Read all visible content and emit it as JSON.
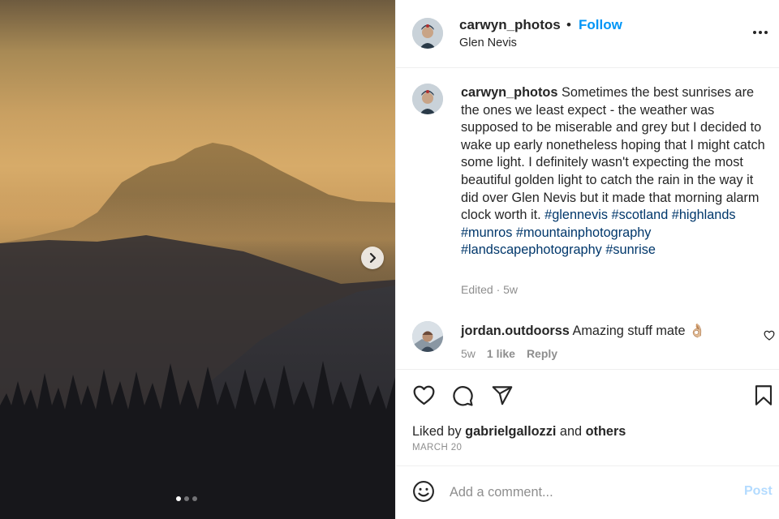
{
  "post": {
    "username": "carwyn_photos",
    "separator": "•",
    "follow_label": "Follow",
    "location": "Glen Nevis",
    "more_icon": "more-horizontal-icon"
  },
  "caption": {
    "username": "carwyn_photos",
    "text": " Sometimes the best sunrises are the ones we least expect - the weather was supposed to be miserable and grey but I decided to wake up early nonetheless hoping that I might catch some light. I definitely wasn't expecting the most beautiful golden light to catch the rain in the way it did over Glen Nevis but it made that morning alarm clock worth it. ",
    "hashtags": [
      "#glennevis",
      "#scotland",
      "#highlands",
      "#munros",
      "#mountainphotography",
      "#landscapephotography",
      "#sunrise"
    ],
    "edited": "Edited · 5w"
  },
  "comment": {
    "username": "jordan.outdoorss",
    "text": " Amazing stuff mate 👌🏼",
    "age": "5w",
    "likes": "1 like",
    "reply_label": "Reply"
  },
  "actions": {
    "liked_prefix": "Liked by ",
    "liked_user": "gabrielgallozzi",
    "liked_and": " and ",
    "liked_others": "others",
    "date": "MARCH 20"
  },
  "composer": {
    "placeholder": "Add a comment...",
    "post_label": "Post"
  },
  "carousel": {
    "current": 1,
    "total": 3
  },
  "colors": {
    "link_blue": "#0095f6",
    "hashtag": "#00376b",
    "muted": "#8e8e8e",
    "post_disabled": "#b3dbff"
  }
}
